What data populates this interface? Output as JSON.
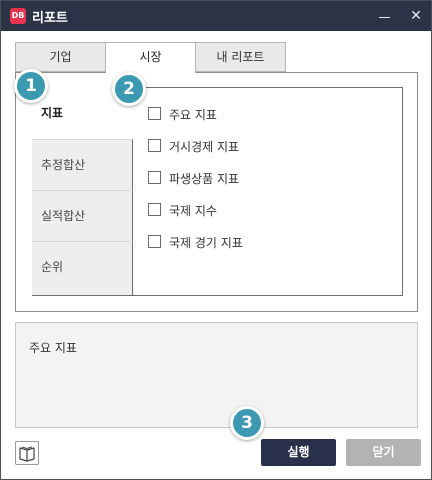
{
  "window": {
    "title": "리포트",
    "app_icon_text": "DB",
    "close_glyph": "✕"
  },
  "tabs": [
    {
      "label": "기업",
      "selected": false
    },
    {
      "label": "시장",
      "selected": true
    },
    {
      "label": "내 리포트",
      "selected": false
    }
  ],
  "categories": [
    {
      "label": "지표",
      "selected": true
    },
    {
      "label": "추정합산",
      "selected": false
    },
    {
      "label": "실적합산",
      "selected": false
    },
    {
      "label": "순위",
      "selected": false
    }
  ],
  "options": [
    {
      "label": "주요 지표",
      "checked": false
    },
    {
      "label": "거시경제 지표",
      "checked": false
    },
    {
      "label": "파생상품 지표",
      "checked": false
    },
    {
      "label": "국제 지수",
      "checked": false
    },
    {
      "label": "국제 경기 지표",
      "checked": false
    }
  ],
  "description": "주요 지표",
  "footer": {
    "help_icon": "book-icon",
    "run_label": "실행",
    "close_label": "닫기"
  },
  "badges": [
    "1",
    "2",
    "3"
  ],
  "colors": {
    "titlebar": "#2b3446",
    "app_icon": "#e8344e",
    "run_button": "#28304a",
    "close_button": "#b3b3b3",
    "badge": "#3b9ab1"
  }
}
